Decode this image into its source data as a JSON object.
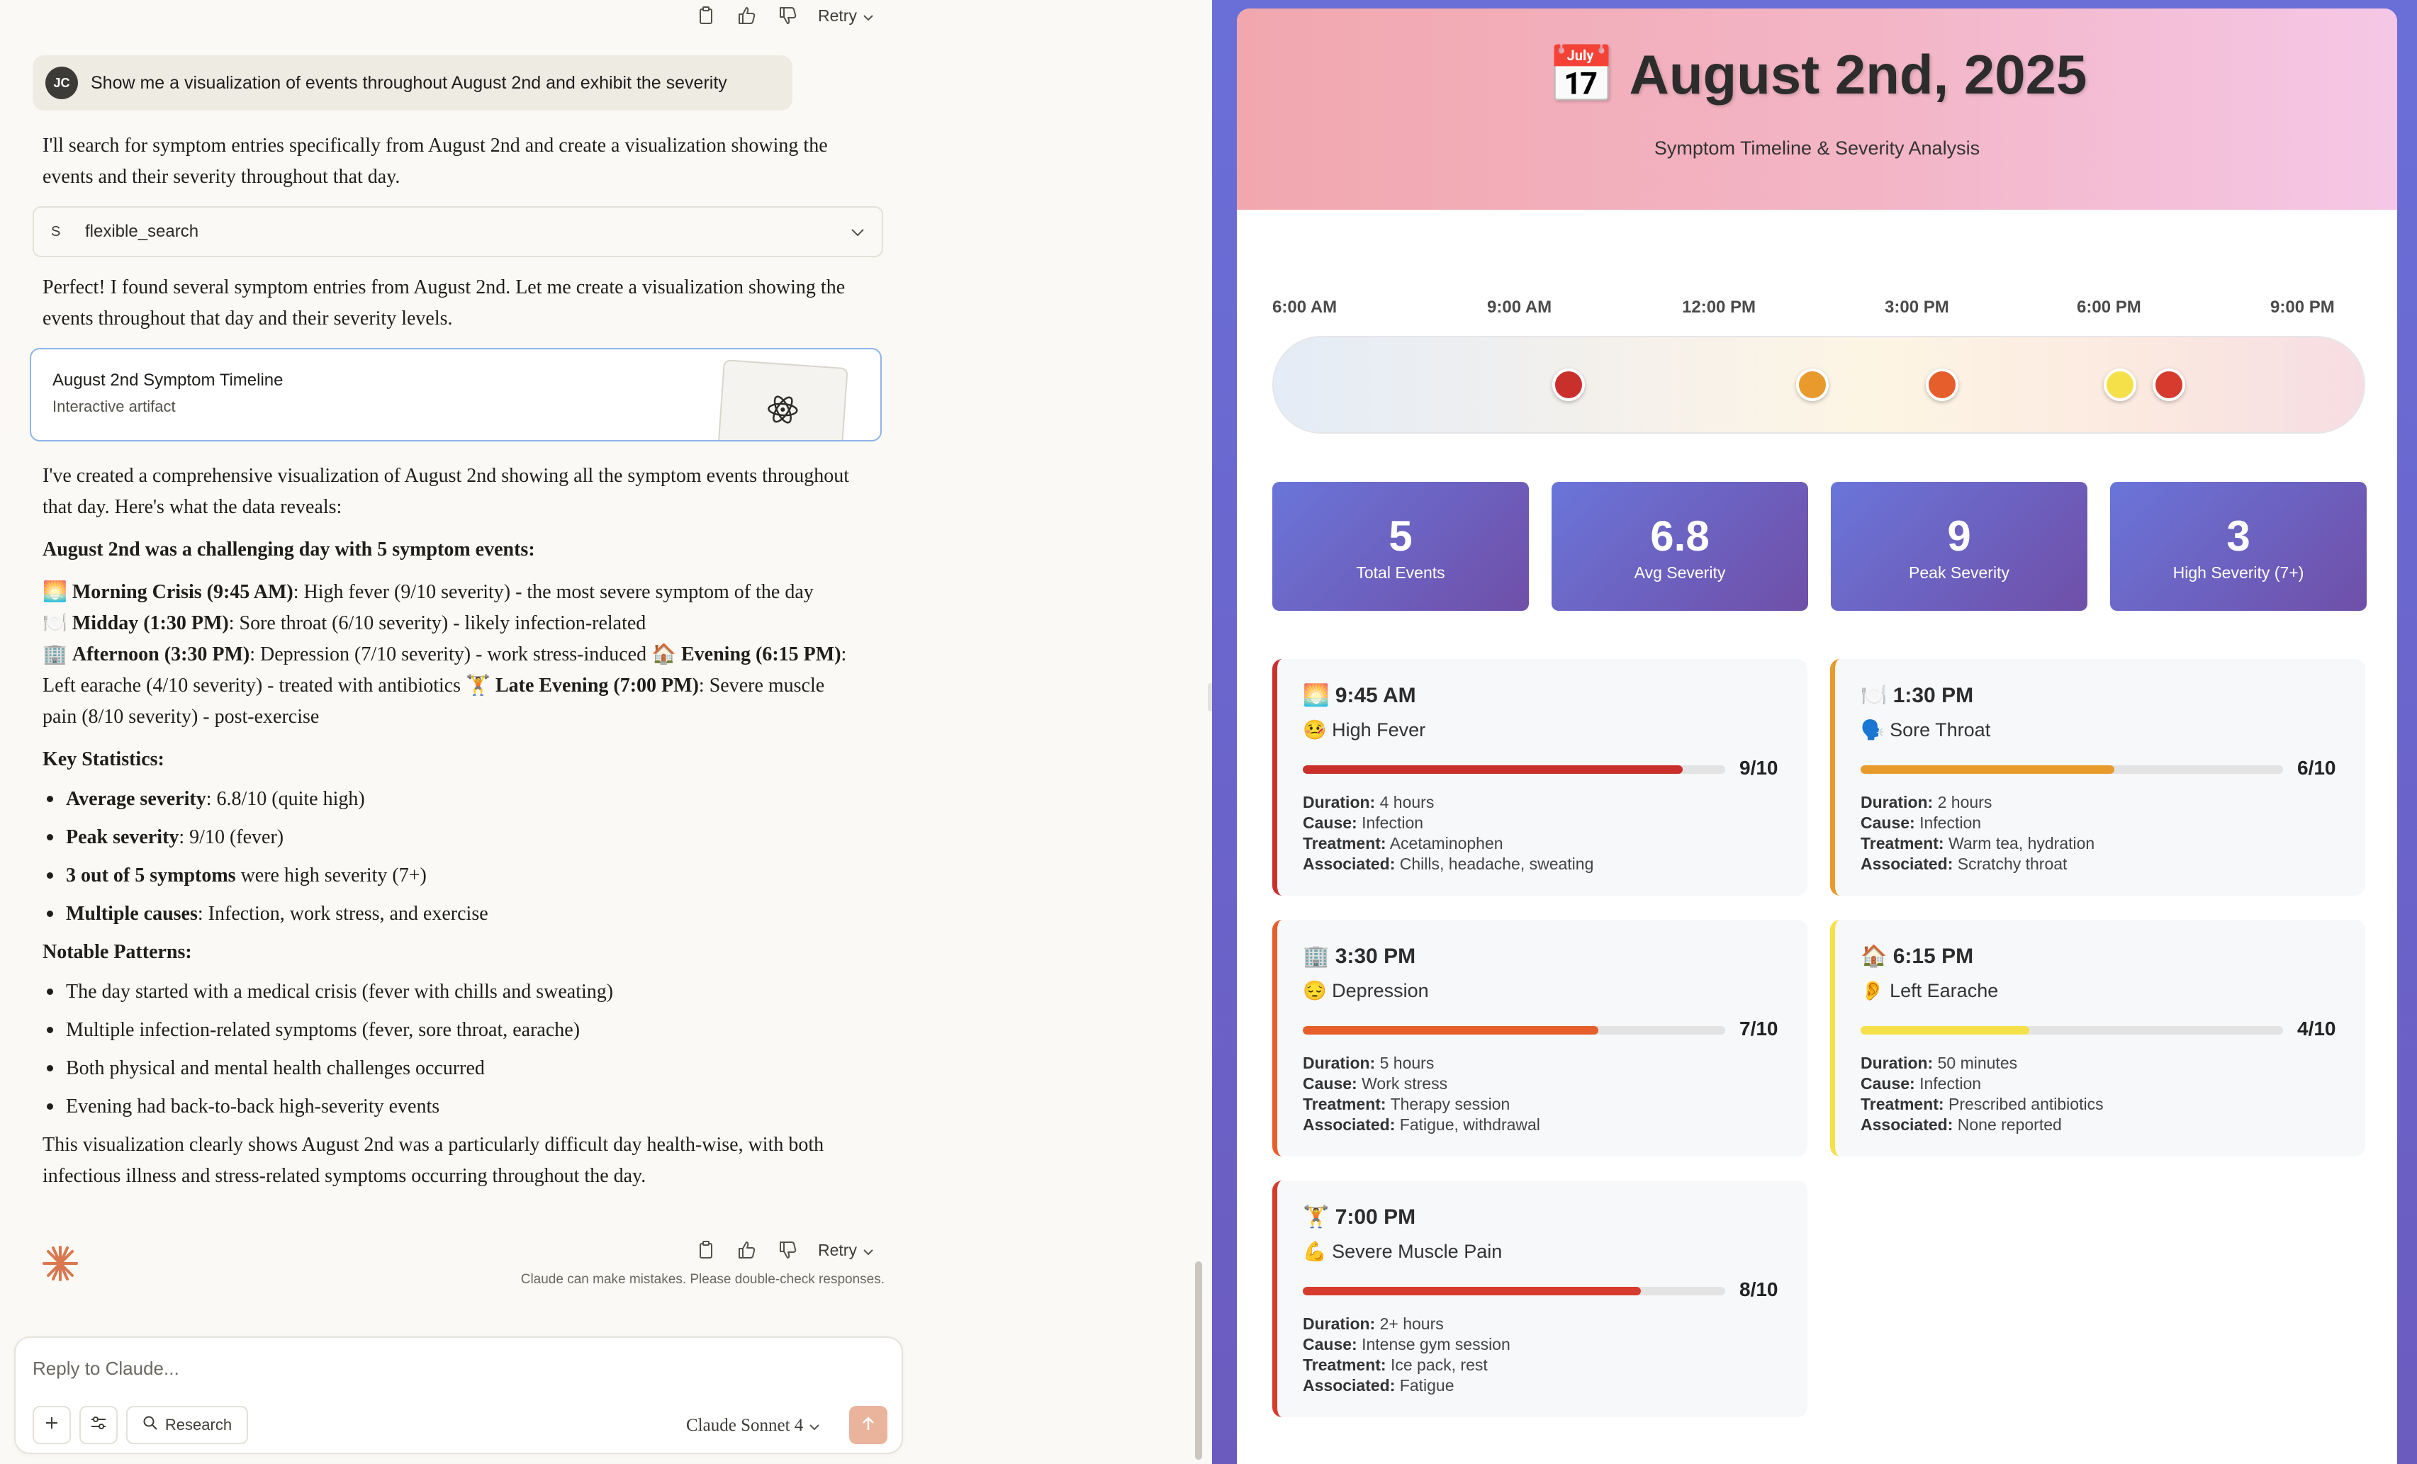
{
  "chat": {
    "actions": {
      "retry_label": "Retry"
    },
    "user_initials": "JC",
    "user_message": "Show me a visualization of events throughout August 2nd and exhibit the severity",
    "intro_text": "I'll search for symptom entries specifically from August 2nd and create a visualization showing the events and their severity throughout that day.",
    "tool": {
      "badge": "S",
      "name": "flexible_search"
    },
    "found_text": "Perfect! I found several symptom entries from August 2nd. Let me create a visualization showing the events throughout that day and their severity levels.",
    "artifact": {
      "title": "August 2nd Symptom Timeline",
      "subtitle": "Interactive artifact"
    },
    "summary_intro": "I've created a comprehensive visualization of August 2nd showing all the symptom events throughout that day. Here's what the data reveals:",
    "challenging_heading": "August 2nd was a challenging day with 5 symptom events:",
    "timeline_items": [
      {
        "emoji": "🌅",
        "label": "Morning Crisis (9:45 AM)",
        "text": ": High fever (9/10 severity) - the most severe symptom of the day"
      },
      {
        "emoji": "🍽️",
        "label": "Midday (1:30 PM)",
        "text": ": Sore throat (6/10 severity) - likely infection-related"
      },
      {
        "emoji": "🏢",
        "label": "Afternoon (3:30 PM)",
        "text": ": Depression (7/10 severity) - work stress-induced "
      },
      {
        "emoji": "🏠",
        "label": "Evening (6:15 PM)",
        "text": ": Left earache (4/10 severity) - treated with antibiotics "
      },
      {
        "emoji": "🏋️",
        "label": "Late Evening (7:00 PM)",
        "text": ": Severe muscle pain (8/10 severity) - post-exercise"
      }
    ],
    "key_stats_heading": "Key Statistics:",
    "key_stats": [
      {
        "bold": "Average severity",
        "text": ": 6.8/10 (quite high)"
      },
      {
        "bold": "Peak severity",
        "text": ": 9/10 (fever)"
      },
      {
        "bold": "3 out of 5 symptoms",
        "text": " were high severity (7+)"
      },
      {
        "bold": "Multiple causes",
        "text": ": Infection, work stress, and exercise"
      }
    ],
    "patterns_heading": "Notable Patterns:",
    "patterns": [
      "The day started with a medical crisis (fever with chills and sweating)",
      "Multiple infection-related symptoms (fever, sore throat, earache)",
      "Both physical and mental health challenges occurred",
      "Evening had back-to-back high-severity events"
    ],
    "conclusion": "This visualization clearly shows August 2nd was a particularly difficult day health-wise, with both infectious illness and stress-related symptoms occurring throughout the day.",
    "disclaimer": "Claude can make mistakes. Please double-check responses.",
    "composer": {
      "placeholder": "Reply to Claude...",
      "research_label": "Research",
      "model_label": "Claude Sonnet 4"
    }
  },
  "artifact_view": {
    "title": "📅 August 2nd, 2025",
    "subtitle": "Symptom Timeline & Severity Analysis",
    "time_ticks": [
      "6:00 AM",
      "9:00 AM",
      "12:00 PM",
      "3:00 PM",
      "6:00 PM",
      "9:00 PM"
    ],
    "timeline_markers": [
      {
        "time": "9:45 AM",
        "severity": 9,
        "color": "#c9302c"
      },
      {
        "time": "1:30 PM",
        "severity": 6,
        "color": "#e89a2c"
      },
      {
        "time": "3:30 PM",
        "severity": 7,
        "color": "#e55e2c"
      },
      {
        "time": "6:15 PM",
        "severity": 4,
        "color": "#f5e04a"
      },
      {
        "time": "7:00 PM",
        "severity": 8,
        "color": "#d63b2d"
      }
    ],
    "stats": [
      {
        "value": "5",
        "label": "Total Events"
      },
      {
        "value": "6.8",
        "label": "Avg Severity"
      },
      {
        "value": "9",
        "label": "Peak Severity"
      },
      {
        "value": "3",
        "label": "High Severity (7+)"
      }
    ],
    "events": [
      {
        "time": "🌅 9:45 AM",
        "name": "🤒 High Fever",
        "score": "9/10",
        "severity": 0.9,
        "color": "#c9302c",
        "duration": "4 hours",
        "cause": "Infection",
        "treatment": "Acetaminophen",
        "associated": "Chills, headache, sweating"
      },
      {
        "time": "🍽️ 1:30 PM",
        "name": "🗣️ Sore Throat",
        "score": "6/10",
        "severity": 0.6,
        "color": "#e89a2c",
        "duration": "2 hours",
        "cause": "Infection",
        "treatment": "Warm tea, hydration",
        "associated": "Scratchy throat"
      },
      {
        "time": "🏢 3:30 PM",
        "name": "😔 Depression",
        "score": "7/10",
        "severity": 0.7,
        "color": "#e55e2c",
        "duration": "5 hours",
        "cause": "Work stress",
        "treatment": "Therapy session",
        "associated": "Fatigue, withdrawal"
      },
      {
        "time": "🏠 6:15 PM",
        "name": "👂 Left Earache",
        "score": "4/10",
        "severity": 0.4,
        "color": "#f5e04a",
        "duration": "50 minutes",
        "cause": "Infection",
        "treatment": "Prescribed antibiotics",
        "associated": "None reported"
      },
      {
        "time": "🏋️ 7:00 PM",
        "name": "💪 Severe Muscle Pain",
        "score": "8/10",
        "severity": 0.8,
        "color": "#d63b2d",
        "duration": "2+ hours",
        "cause": "Intense gym session",
        "treatment": "Ice pack, rest",
        "associated": "Fatigue"
      }
    ],
    "detail_labels": {
      "duration": "Duration:",
      "cause": "Cause:",
      "treatment": "Treatment:",
      "associated": "Associated:"
    }
  }
}
